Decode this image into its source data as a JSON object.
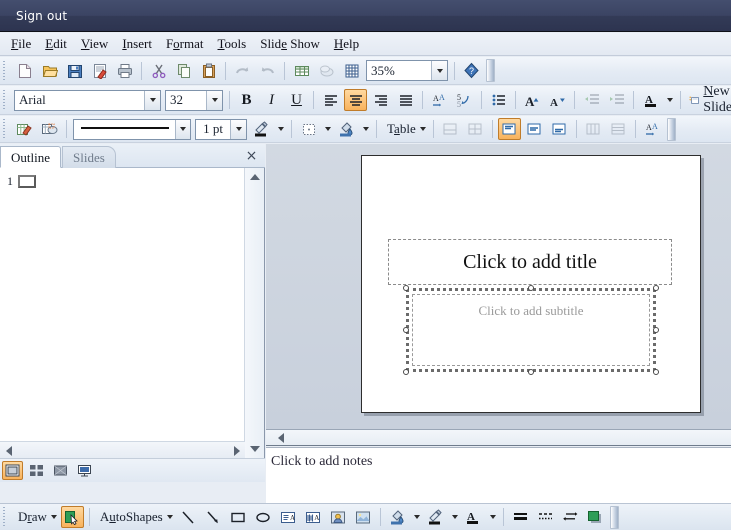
{
  "titlebar": {
    "signout": "Sign out"
  },
  "menubar": {
    "items": [
      {
        "label": "File",
        "accel": "F"
      },
      {
        "label": "Edit",
        "accel": "E"
      },
      {
        "label": "View",
        "accel": "V"
      },
      {
        "label": "Insert",
        "accel": "I"
      },
      {
        "label": "Format",
        "accel": "o"
      },
      {
        "label": "Tools",
        "accel": "T"
      },
      {
        "label": "Slide Show",
        "accel": "e"
      },
      {
        "label": "Help",
        "accel": "H"
      }
    ]
  },
  "standard_toolbar": {
    "buttons": [
      {
        "name": "new-icon",
        "title": "New"
      },
      {
        "name": "open-icon",
        "title": "Open"
      },
      {
        "name": "save-icon",
        "title": "Save"
      },
      {
        "name": "publish-icon",
        "title": "Publish"
      },
      {
        "name": "print-icon",
        "title": "Print"
      },
      {
        "name": "cut-icon",
        "title": "Cut"
      },
      {
        "name": "copy-icon",
        "title": "Copy"
      },
      {
        "name": "paste-icon",
        "title": "Paste"
      },
      {
        "name": "undo-icon",
        "title": "Undo"
      },
      {
        "name": "redo-icon",
        "title": "Redo"
      },
      {
        "name": "insert-table-icon",
        "title": "Insert Table"
      },
      {
        "name": "insert-chart-icon",
        "title": "Insert Chart"
      },
      {
        "name": "grid-icon",
        "title": "Show Grid"
      },
      {
        "name": "help-icon",
        "title": "Help"
      }
    ],
    "zoom_value": "35%"
  },
  "formatting_toolbar": {
    "font_name": "Arial",
    "font_size": "32",
    "bold_label": "B",
    "italic_label": "I",
    "underline_label": "U",
    "align": {
      "left": "align-left",
      "center": "align-center",
      "right": "align-right",
      "justify": "align-justify",
      "active": "center"
    },
    "buttons": [
      {
        "name": "change-case-icon"
      },
      {
        "name": "line-spacing-icon"
      },
      {
        "name": "bullets-icon"
      },
      {
        "name": "increase-font-size-icon"
      },
      {
        "name": "decrease-font-size-icon"
      },
      {
        "name": "promote-icon"
      },
      {
        "name": "demote-icon"
      },
      {
        "name": "font-color-icon"
      }
    ],
    "new_slide_label": "New Slide",
    "new_slide_accel": "N"
  },
  "drawing_format_toolbar": {
    "line_style_value": "",
    "line_weight_value": "1 pt",
    "table_label": "Table",
    "table_accel": "a",
    "buttons": [
      {
        "name": "insert-picture-icon"
      },
      {
        "name": "picture-effects-icon"
      },
      {
        "name": "line-color-icon"
      },
      {
        "name": "dash-style-icon"
      },
      {
        "name": "fill-color-icon"
      },
      {
        "name": "merge-cells-icon"
      },
      {
        "name": "split-cells-icon"
      },
      {
        "name": "align-top-icon"
      },
      {
        "name": "align-middle-icon"
      },
      {
        "name": "align-bottom-icon"
      },
      {
        "name": "distribute-columns-icon"
      },
      {
        "name": "distribute-rows-icon"
      },
      {
        "name": "text-direction-icon"
      }
    ],
    "active_button": "align-top-icon"
  },
  "left_panel": {
    "tabs": [
      {
        "label": "Outline",
        "active": true
      },
      {
        "label": "Slides",
        "active": false
      }
    ],
    "close_label": "×",
    "outline_items": [
      {
        "number": "1",
        "text": ""
      }
    ]
  },
  "view_buttons": [
    {
      "name": "normal-view-button",
      "active": true
    },
    {
      "name": "slide-sorter-view-button",
      "active": false
    },
    {
      "name": "notes-view-button",
      "active": false
    },
    {
      "name": "slide-show-button",
      "active": false
    }
  ],
  "slide": {
    "title_placeholder": "Click to add title",
    "subtitle_placeholder": "Click to add subtitle",
    "selected_placeholder": "subtitle"
  },
  "notes": {
    "placeholder": "Click to add notes"
  },
  "drawing_toolbar": {
    "draw_label": "Draw",
    "draw_accel": "r",
    "autoshapes_label": "AutoShapes",
    "autoshapes_accel": "u",
    "buttons": [
      {
        "name": "select-objects-icon",
        "active": true
      },
      {
        "name": "line-icon"
      },
      {
        "name": "arrow-icon"
      },
      {
        "name": "rectangle-icon"
      },
      {
        "name": "oval-icon"
      },
      {
        "name": "text-box-icon"
      },
      {
        "name": "word-art-icon"
      },
      {
        "name": "clip-art-icon"
      },
      {
        "name": "picture-icon"
      },
      {
        "name": "fill-color-icon"
      },
      {
        "name": "line-color-icon"
      },
      {
        "name": "font-color-icon"
      },
      {
        "name": "line-style-icon"
      },
      {
        "name": "dash-style-icon"
      },
      {
        "name": "arrow-style-icon"
      },
      {
        "name": "shadow-style-icon"
      }
    ]
  },
  "colors": {
    "titlebar_dark": "#39415f",
    "toolbar_bg": "#e4ebf4",
    "workspace_bg": "#ccd4de",
    "accent_orange": "#f8b25c",
    "selection_border": "#c07c2a"
  }
}
